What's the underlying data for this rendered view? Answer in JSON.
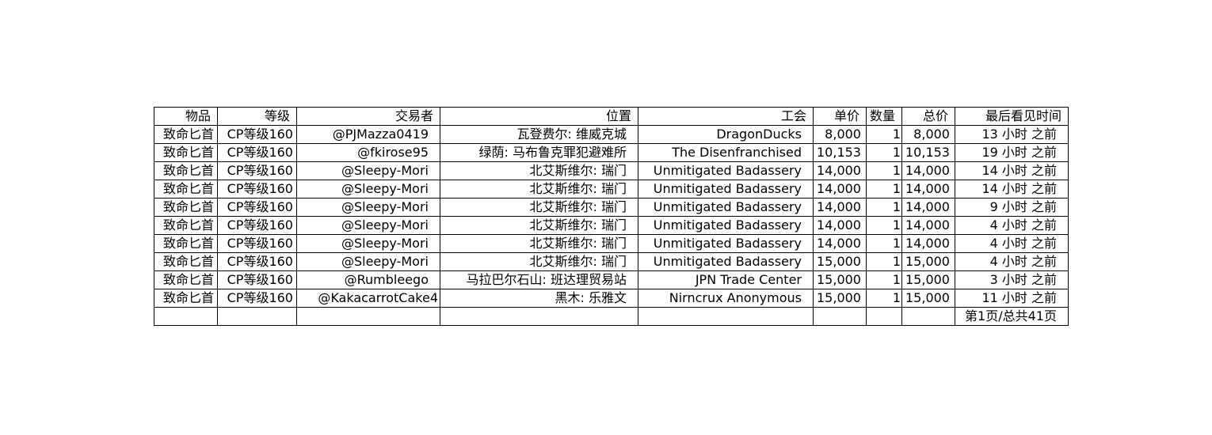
{
  "table": {
    "headers": [
      "物品",
      "等级",
      "交易者",
      "位置",
      "工会",
      "单价",
      "数量",
      "总价",
      "最后看见时间"
    ],
    "rows": [
      [
        "致命匕首",
        "CP等级160",
        "@PJMazza0419",
        "瓦登费尔: 维威克城",
        "DragonDucks",
        "8,000",
        "1",
        "8,000",
        "13 小时 之前"
      ],
      [
        "致命匕首",
        "CP等级160",
        "@fkirose95",
        "绿荫: 马布鲁克罪犯避难所",
        "The Disenfranchised",
        "10,153",
        "1",
        "10,153",
        "19 小时 之前"
      ],
      [
        "致命匕首",
        "CP等级160",
        "@Sleepy-Mori",
        "北艾斯维尔: 瑞门",
        "Unmitigated Badassery",
        "14,000",
        "1",
        "14,000",
        "14 小时 之前"
      ],
      [
        "致命匕首",
        "CP等级160",
        "@Sleepy-Mori",
        "北艾斯维尔: 瑞门",
        "Unmitigated Badassery",
        "14,000",
        "1",
        "14,000",
        "14 小时 之前"
      ],
      [
        "致命匕首",
        "CP等级160",
        "@Sleepy-Mori",
        "北艾斯维尔: 瑞门",
        "Unmitigated Badassery",
        "14,000",
        "1",
        "14,000",
        "9 小时 之前"
      ],
      [
        "致命匕首",
        "CP等级160",
        "@Sleepy-Mori",
        "北艾斯维尔: 瑞门",
        "Unmitigated Badassery",
        "14,000",
        "1",
        "14,000",
        "4 小时 之前"
      ],
      [
        "致命匕首",
        "CP等级160",
        "@Sleepy-Mori",
        "北艾斯维尔: 瑞门",
        "Unmitigated Badassery",
        "14,000",
        "1",
        "14,000",
        "4 小时 之前"
      ],
      [
        "致命匕首",
        "CP等级160",
        "@Sleepy-Mori",
        "北艾斯维尔: 瑞门",
        "Unmitigated Badassery",
        "15,000",
        "1",
        "15,000",
        "4 小时 之前"
      ],
      [
        "致命匕首",
        "CP等级160",
        "@Rumbleego",
        "马拉巴尔石山: 班达理贸易站",
        "JPN Trade Center",
        "15,000",
        "1",
        "15,000",
        "3 小时 之前"
      ],
      [
        "致命匕首",
        "CP等级160",
        "@KakacarrotCake4",
        "黑木: 乐雅文",
        "Nirncrux Anonymous",
        "15,000",
        "1",
        "15,000",
        "11 小时 之前"
      ]
    ],
    "pagination": "第1页/总共41页"
  }
}
